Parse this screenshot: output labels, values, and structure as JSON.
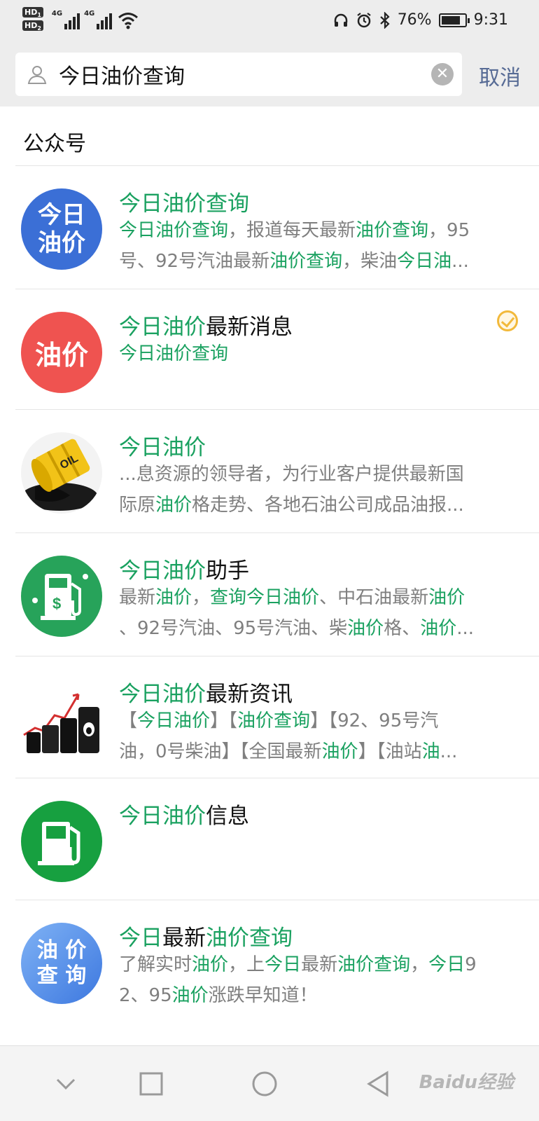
{
  "status_bar": {
    "hd1": "HD",
    "hd1_sub": "1",
    "hd2": "HD",
    "hd2_sub": "2",
    "net1": "4G",
    "net2": "4G",
    "battery": "76%",
    "time": "9:31"
  },
  "search": {
    "query": "今日油价查询",
    "cancel_label": "取消"
  },
  "section": {
    "title": "公众号"
  },
  "results": [
    {
      "avatar_text": [
        "今日",
        "油价"
      ],
      "avatar_color": "#3b6fd6",
      "title": [
        {
          "t": "今日油价查询",
          "h": true
        }
      ],
      "desc_line1": [
        {
          "t": "今日油价查询",
          "h": true
        },
        {
          "t": "，报道每天最新",
          "h": false
        },
        {
          "t": "油价查询",
          "h": true
        },
        {
          "t": "，95",
          "h": false
        }
      ],
      "desc_line2": [
        {
          "t": "号、92号汽油最新",
          "h": false
        },
        {
          "t": "油价查询",
          "h": true
        },
        {
          "t": "，柴油",
          "h": false
        },
        {
          "t": "今日油",
          "h": true
        },
        {
          "t": "...",
          "h": false
        }
      ]
    },
    {
      "avatar_text": [
        "油价"
      ],
      "avatar_color": "#ef5350",
      "verified": true,
      "title": [
        {
          "t": "今日油价",
          "h": true
        },
        {
          "t": "最新消息",
          "h": false
        }
      ],
      "desc_line1": [
        {
          "t": "今日油价查询",
          "h": true
        }
      ],
      "desc_line2": []
    },
    {
      "avatar_icon": "oil-barrel-icon",
      "avatar_text": [
        "OIL"
      ],
      "title": [
        {
          "t": "今日油价",
          "h": true
        }
      ],
      "desc_line1": [
        {
          "t": "...息资源的领导者，为行业客户提供最新国",
          "h": false
        }
      ],
      "desc_line2": [
        {
          "t": "际原",
          "h": false
        },
        {
          "t": "油价",
          "h": true
        },
        {
          "t": "格走势、各地石油公司成品油报...",
          "h": false
        }
      ]
    },
    {
      "avatar_icon": "fuel-pump-dollar-icon",
      "avatar_color": "#27a35a",
      "title": [
        {
          "t": "今日油价",
          "h": true
        },
        {
          "t": "助手",
          "h": false
        }
      ],
      "desc_line1": [
        {
          "t": "最新",
          "h": false
        },
        {
          "t": "油价",
          "h": true
        },
        {
          "t": "，",
          "h": false
        },
        {
          "t": "查询今日油价",
          "h": true
        },
        {
          "t": "、中石油最新",
          "h": false
        },
        {
          "t": "油价",
          "h": true
        }
      ],
      "desc_line2": [
        {
          "t": "、92号汽油、95号汽油、柴",
          "h": false
        },
        {
          "t": "油价",
          "h": true
        },
        {
          "t": "格、",
          "h": false
        },
        {
          "t": "油价",
          "h": true
        },
        {
          "t": "...",
          "h": false
        }
      ]
    },
    {
      "avatar_icon": "oil-barrels-chart-icon",
      "title": [
        {
          "t": "今日油价",
          "h": true
        },
        {
          "t": "最新资讯",
          "h": false
        }
      ],
      "desc_line1": [
        {
          "t": "【",
          "h": false
        },
        {
          "t": "今日油价",
          "h": true
        },
        {
          "t": "】【",
          "h": false
        },
        {
          "t": "油价查询",
          "h": true
        },
        {
          "t": "】【92、95号汽",
          "h": false
        }
      ],
      "desc_line2": [
        {
          "t": "油，0号柴油】【全国最新",
          "h": false
        },
        {
          "t": "油价",
          "h": true
        },
        {
          "t": "】【油站",
          "h": false
        },
        {
          "t": "油",
          "h": true
        },
        {
          "t": "...",
          "h": false
        }
      ]
    },
    {
      "avatar_icon": "fuel-pump-icon",
      "avatar_color": "#17a040",
      "title": [
        {
          "t": "今日油价",
          "h": true
        },
        {
          "t": "信息",
          "h": false
        }
      ],
      "desc_line1": [],
      "desc_line2": []
    },
    {
      "avatar_text": [
        "油 价",
        "查 询"
      ],
      "avatar_color": "#4d8ee8",
      "title": [
        {
          "t": "今日",
          "h": true
        },
        {
          "t": "最新",
          "h": false
        },
        {
          "t": "油价查询",
          "h": true
        }
      ],
      "desc_line1": [
        {
          "t": "了解实时",
          "h": false
        },
        {
          "t": "油价",
          "h": true
        },
        {
          "t": "，上",
          "h": false
        },
        {
          "t": "今日",
          "h": true
        },
        {
          "t": "最新",
          "h": false
        },
        {
          "t": "油价查询",
          "h": true
        },
        {
          "t": "，",
          "h": false
        },
        {
          "t": "今日",
          "h": true
        },
        {
          "t": "9",
          "h": false
        }
      ],
      "desc_line2": [
        {
          "t": "2、95",
          "h": false
        },
        {
          "t": "油价",
          "h": true
        },
        {
          "t": "涨跌早知道！",
          "h": false
        }
      ]
    }
  ],
  "watermark": "Baidu经验"
}
